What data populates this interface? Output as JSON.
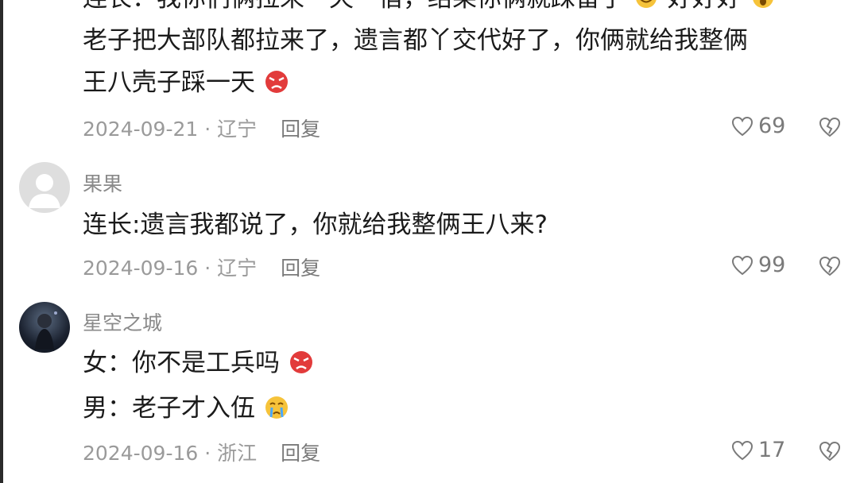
{
  "comments": [
    {
      "line0": "连长：我你们俩拉来一天一宿，结果你俩就踩雷了",
      "line0_tail": "好好好",
      "line1": "老子把大部队都拉来了，遗言都丫交代好了，你俩就给我整俩",
      "line2": "王八壳子踩一天",
      "date_loc": "2024-09-21 · 辽宁",
      "reply": "回复",
      "likes": "69"
    },
    {
      "username": "果果",
      "text": "连长:遗言我都说了，你就给我整俩王八来?",
      "date_loc": "2024-09-16 · 辽宁",
      "reply": "回复",
      "likes": "99"
    },
    {
      "username": "星空之城",
      "line1": "女：你不是工兵吗",
      "line2": "男：老子才入伍",
      "date_loc": "2024-09-16 · 浙江",
      "reply": "回复",
      "likes": "17"
    }
  ],
  "icons": {
    "like": "heart-outline-icon",
    "dislike": "broken-heart-icon",
    "angry": "angry-face-emoji",
    "crying": "crying-face-emoji",
    "smile": "smile-emoji",
    "shocked": "shocked-emoji"
  },
  "colors": {
    "text": "#1b1b1b",
    "meta": "#9a9a9a",
    "angry": "#e23b3b",
    "emoji_yellow": "#f6c33a"
  }
}
